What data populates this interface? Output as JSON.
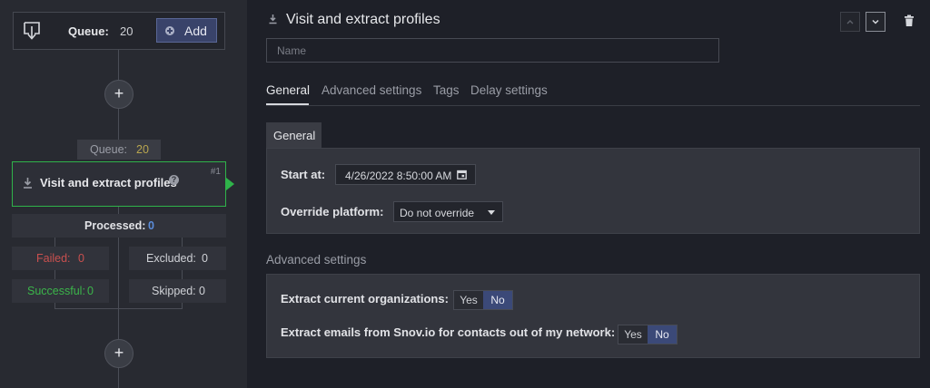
{
  "flow": {
    "queue_label": "Queue:",
    "queue_count": "20",
    "add_label": "Add",
    "plus_symbol": "+",
    "pill_label": "Queue:",
    "pill_count": "20",
    "step_title": "Visit and extract profiles",
    "step_help": "?",
    "step_number": "#1",
    "processed_label": "Processed:",
    "processed_value": "0",
    "failed_label": "Failed:",
    "failed_value": "0",
    "excluded_label": "Excluded:",
    "excluded_value": "0",
    "successful_label": "Successful:",
    "successful_value": "0",
    "skipped_label": "Skipped:",
    "skipped_value": "0"
  },
  "editor": {
    "title": "Visit and extract profiles",
    "name_placeholder": "Name",
    "tabs": [
      {
        "label": "General"
      },
      {
        "label": "Advanced settings"
      },
      {
        "label": "Tags"
      },
      {
        "label": "Delay settings"
      }
    ],
    "general_section_label": "General",
    "start_at_label": "Start at:",
    "start_at_value": "4/26/2022 8:50:00 AM",
    "override_label": "Override platform:",
    "override_value": "Do not override",
    "advanced_heading": "Advanced settings",
    "extract_orgs_label": "Extract current organizations:",
    "extract_emails_label": "Extract emails from Snov.io for contacts out of my network:",
    "yes": "Yes",
    "no": "No"
  },
  "colors": {
    "accent_green": "#2fb34a",
    "accent_blue": "#3b4978",
    "failed_red": "#c9504f",
    "success_green": "#3bb54a",
    "processed_blue": "#5b8ddb"
  }
}
